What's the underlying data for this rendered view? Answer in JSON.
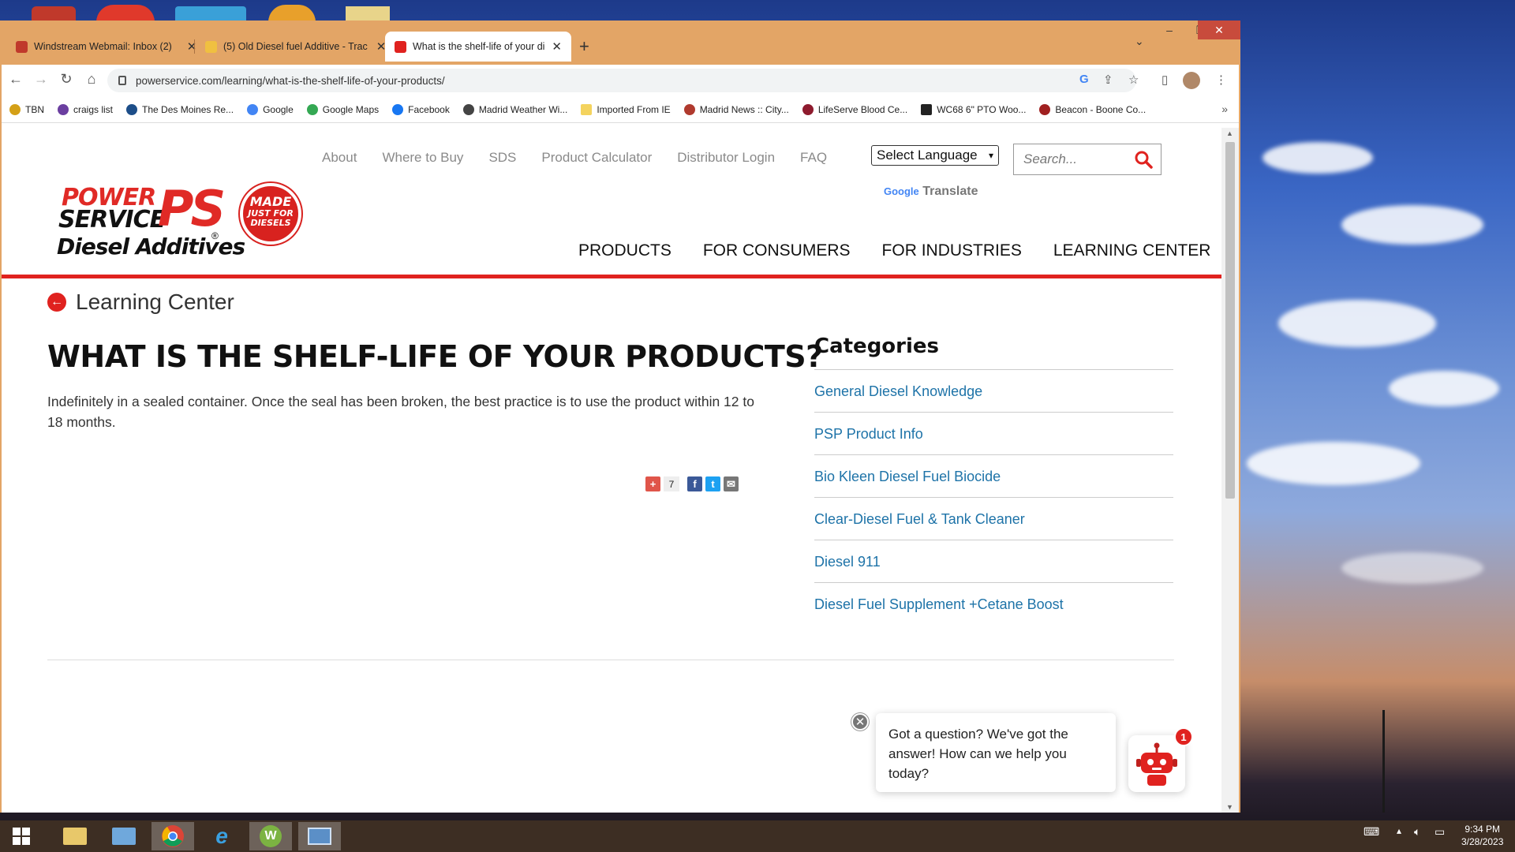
{
  "browser": {
    "tabs": [
      {
        "title": "Windstream Webmail: Inbox (2)",
        "active": false,
        "favicon_color": "#c0392b"
      },
      {
        "title": "(5) Old Diesel fuel Additive - Trac",
        "active": false,
        "favicon_color": "#f0c040"
      },
      {
        "title": "What is the shelf-life of your dies",
        "active": true,
        "favicon_color": "#e0221f"
      }
    ],
    "url": "powerservice.com/learning/what-is-the-shelf-life-of-your-products/",
    "bookmarks": [
      {
        "label": "TBN",
        "color": "#d4a017"
      },
      {
        "label": "craigs list",
        "color": "#6b3fa0"
      },
      {
        "label": "The Des Moines Re...",
        "color": "#1d4e89"
      },
      {
        "label": "Google",
        "color": "#4285f4"
      },
      {
        "label": "Google Maps",
        "color": "#34a853"
      },
      {
        "label": "Facebook",
        "color": "#1877f2"
      },
      {
        "label": "Madrid Weather Wi...",
        "color": "#444444"
      },
      {
        "label": "Imported From IE",
        "color": "#f4d35e"
      },
      {
        "label": "Madrid News :: City...",
        "color": "#b03a2e"
      },
      {
        "label": "LifeServe Blood Ce...",
        "color": "#8e1b2e"
      },
      {
        "label": "WC68 6\" PTO Woo...",
        "color": "#222222"
      },
      {
        "label": "Beacon - Boone Co...",
        "color": "#a02020"
      }
    ]
  },
  "site": {
    "top_links": [
      "About",
      "Where to Buy",
      "SDS",
      "Product Calculator",
      "Distributor Login",
      "FAQ"
    ],
    "language_select": "Select Language",
    "google_word": "Google",
    "translate_word": "Translate",
    "search_placeholder": "Search...",
    "logo": {
      "line1": "POWER",
      "line2": "SERVICE",
      "mark": "PS",
      "tagline": "Diesel Additives",
      "registered": "®"
    },
    "badge": {
      "line1": "MADE",
      "line2": "JUST FOR",
      "line3": "DIESELS"
    },
    "main_nav": [
      "PRODUCTS",
      "FOR CONSUMERS",
      "FOR INDUSTRIES",
      "LEARNING CENTER"
    ],
    "back_label": "Learning Center",
    "article": {
      "title": "WHAT IS THE SHELF-LIFE OF YOUR PRODUCTS?",
      "body": "Indefinitely in a sealed container. Once the seal has been broken, the best practice is to use the product within 12 to 18 months."
    },
    "share": {
      "count": "7"
    },
    "sidebar": {
      "title": "Categories",
      "items": [
        "General Diesel Knowledge",
        "PSP Product Info",
        "Bio Kleen Diesel Fuel Biocide",
        "Clear-Diesel Fuel & Tank Cleaner",
        "Diesel 911",
        "Diesel Fuel Supplement +Cetane Boost"
      ]
    },
    "chat": {
      "message": "Got a question? We've got the answer! How can we help you today?",
      "badge_count": "1"
    }
  },
  "taskbar": {
    "time": "9:34 PM",
    "date": "3/28/2023"
  },
  "colors": {
    "brand_red": "#e0221f",
    "link_blue": "#1e73a8",
    "tab_bar": "#e3a566"
  }
}
